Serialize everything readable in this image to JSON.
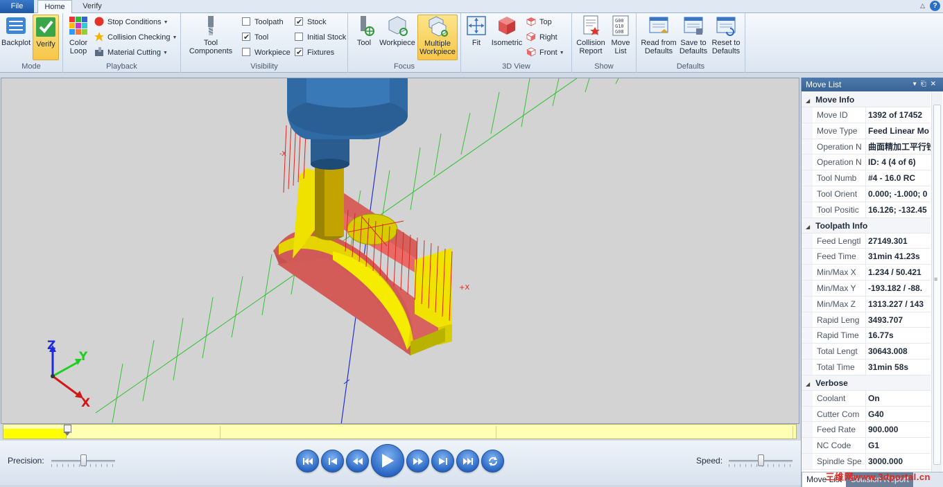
{
  "tabs": {
    "file": "File",
    "home": "Home",
    "verify": "Verify"
  },
  "ribbon": {
    "mode": {
      "label": "Mode",
      "backplot": "Backplot",
      "verify": "Verify"
    },
    "playback": {
      "label": "Playback",
      "color_loop": "Color Loop",
      "stop_conditions": "Stop Conditions",
      "collision_checking": "Collision Checking",
      "material_cutting": "Material Cutting"
    },
    "visibility": {
      "label": "Visibility",
      "tool_components": "Tool Components",
      "checks": [
        {
          "label": "Toolpath",
          "checked": false
        },
        {
          "label": "Tool",
          "checked": true
        },
        {
          "label": "Workpiece",
          "checked": false
        },
        {
          "label": "Stock",
          "checked": true
        },
        {
          "label": "Initial Stock",
          "checked": false
        },
        {
          "label": "Fixtures",
          "checked": true
        }
      ]
    },
    "focus": {
      "label": "Focus",
      "tool": "Tool",
      "workpiece": "Workpiece",
      "multiple_workpiece": "Multiple Workpiece"
    },
    "view3d": {
      "label": "3D View",
      "fit": "Fit",
      "isometric": "Isometric",
      "top": "Top",
      "right": "Right",
      "front": "Front"
    },
    "show": {
      "label": "Show",
      "collision_report": "Collision Report",
      "move_list": "Move List"
    },
    "defaults": {
      "label": "Defaults",
      "read": "Read from Defaults",
      "save": "Save to Defaults",
      "reset": "Reset to Defaults"
    }
  },
  "viewport": {
    "axis_x": "X",
    "axis_y": "Y",
    "axis_z": "Z",
    "marker_minus": "-X",
    "marker_plus": "+X"
  },
  "timeline": {
    "progress": 0.08
  },
  "controls": {
    "precision_label": "Precision:",
    "speed_label": "Speed:",
    "precision_value": 0.5,
    "speed_value": 0.5
  },
  "movelist": {
    "title": "Move List",
    "categories": [
      {
        "name": "Move Info",
        "rows": [
          {
            "name": "Move ID",
            "value": "1392 of 17452"
          },
          {
            "name": "Move Type",
            "value": "Feed Linear Mo"
          },
          {
            "name": "Operation N",
            "value": "曲面精加工平行铣"
          },
          {
            "name": "Operation N",
            "value": "ID: 4 (4 of 6)"
          },
          {
            "name": "Tool Numb",
            "value": "#4 - 16.0 RC"
          },
          {
            "name": "Tool Orient",
            "value": "0.000; -1.000; 0"
          },
          {
            "name": "Tool Positic",
            "value": "16.126; -132.45"
          }
        ]
      },
      {
        "name": "Toolpath Info",
        "rows": [
          {
            "name": "Feed Lengtl",
            "value": "27149.301"
          },
          {
            "name": "Feed Time",
            "value": "31min 41.23s"
          },
          {
            "name": "Min/Max X",
            "value": "1.234 / 50.421"
          },
          {
            "name": "Min/Max Y",
            "value": "-193.182 / -88."
          },
          {
            "name": "Min/Max Z",
            "value": "1313.227 / 143"
          },
          {
            "name": "Rapid Leng",
            "value": "3493.707"
          },
          {
            "name": "Rapid Time",
            "value": "16.77s"
          },
          {
            "name": "Total Lengt",
            "value": "30643.008"
          },
          {
            "name": "Total Time",
            "value": "31min 58s"
          }
        ]
      },
      {
        "name": "Verbose",
        "rows": [
          {
            "name": "Coolant",
            "value": "On"
          },
          {
            "name": "Cutter Com",
            "value": "G40"
          },
          {
            "name": "Feed Rate",
            "value": "900.000"
          },
          {
            "name": "NC Code",
            "value": "G1"
          },
          {
            "name": "Spindle Spe",
            "value": "3000.000"
          }
        ]
      }
    ],
    "tab_list": "Move List",
    "tab_collision": "Collision Report"
  },
  "watermark": "三维网www.3dportal.cn"
}
